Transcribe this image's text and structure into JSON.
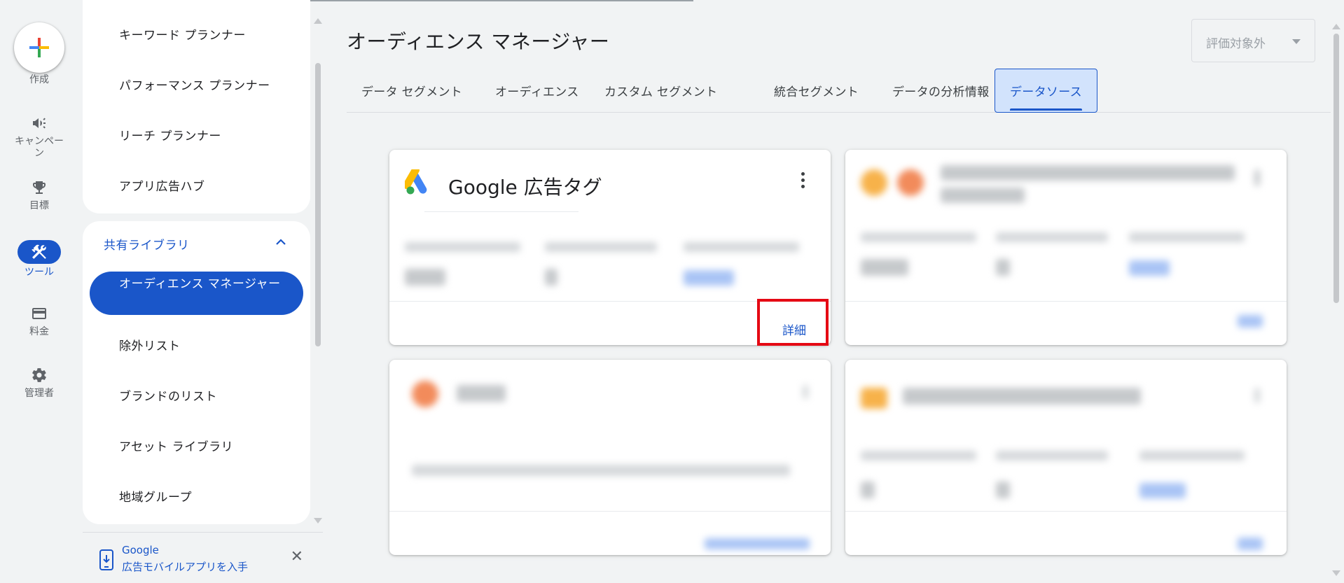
{
  "rail": {
    "create": "作成",
    "campaign": "キャンペーン",
    "goals": "目標",
    "tools": "ツール",
    "billing": "料金",
    "admin": "管理者"
  },
  "nav": {
    "top_items": [
      "キーワード プランナー",
      "パフォーマンス プランナー",
      "リーチ プランナー",
      "アプリ広告ハブ"
    ],
    "section": "共有ライブラリ",
    "active_item": "オーディエンス マネージャー",
    "items": [
      "除外リスト",
      "ブランドのリスト",
      "アセット ライブラリ",
      "地域グループ"
    ]
  },
  "promo": {
    "line1": "Google",
    "line2": "広告モバイルアプリを入手"
  },
  "header": {
    "title": "オーディエンス マネージャー",
    "filter_value": "評価対象外"
  },
  "tabs": [
    "データ セグメント",
    "オーディエンス",
    "カスタム セグメント",
    "統合セグメント",
    "データの分析情報",
    "データソース"
  ],
  "cards": {
    "google_ads_tag": {
      "title": "Google 広告タグ",
      "detail_link": "詳細"
    }
  },
  "colors": {
    "accent": "#1a56c9",
    "highlight": "#e50914"
  }
}
